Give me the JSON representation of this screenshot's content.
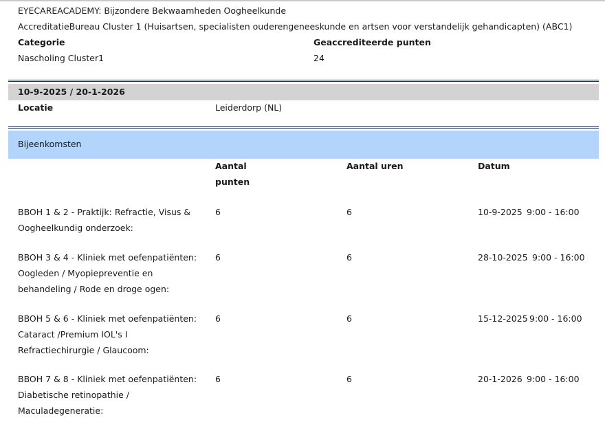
{
  "course": {
    "title": "EYECAREACADEMY: Bijzondere Bekwaamheden Oogheelkunde",
    "accreditation": "AccreditatieBureau Cluster 1 (Huisartsen, specialisten ouderengeneeskunde en artsen voor verstandelijk gehandicapten) (ABC1)",
    "category_label": "Categorie",
    "category_value": "Nascholing Cluster1",
    "points_label": "Geaccrediteerde punten",
    "points_value": "24"
  },
  "session": {
    "date_range": "10-9-2025 / 20-1-2026",
    "location_label": "Locatie",
    "location_value": "Leiderdorp (NL)"
  },
  "meetings": {
    "section_title": "Bijeenkomsten",
    "headers": {
      "points_line1": "Aantal",
      "points_line2": "punten",
      "hours": "Aantal uren",
      "date": "Datum"
    },
    "rows": [
      {
        "name_lines": [
          "BBOH 1 & 2 - Praktijk: Refractie, Visus &",
          "Oogheelkundig onderzoek:"
        ],
        "points": "6",
        "hours": "6",
        "date": "10-9-2025",
        "time": "9:00 - 16:00"
      },
      {
        "name_lines": [
          "BBOH 3 & 4 - Kliniek met oefenpatiënten:",
          "Oogleden / Myopiepreventie en",
          "behandeling / Rode en droge ogen:"
        ],
        "points": "6",
        "hours": "6",
        "date": "28-10-2025",
        "time": "9:00 - 16:00"
      },
      {
        "name_lines": [
          "BBOH 5 & 6 - Kliniek met oefenpatiënten:",
          "Cataract /Premium IOL's I",
          "Refractiechirurgie / Glaucoom:"
        ],
        "points": "6",
        "hours": "6",
        "date": "15-12-2025",
        "time": "9:00 - 16:00"
      },
      {
        "name_lines": [
          "BBOH 7 & 8 - Kliniek met oefenpatiënten:",
          "Diabetische retinopathie /",
          "Maculadegeneratie:"
        ],
        "points": "6",
        "hours": "6",
        "date": "20-1-2026",
        "time": "9:00 - 16:00"
      }
    ]
  }
}
